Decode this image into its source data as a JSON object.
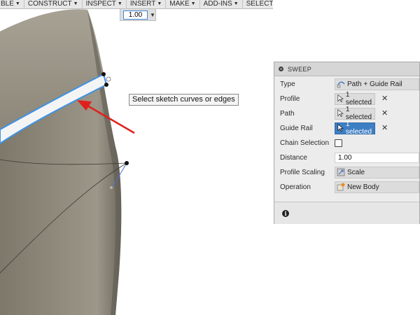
{
  "toolbar": {
    "items": [
      {
        "label": "BLE"
      },
      {
        "label": "CONSTRUCT"
      },
      {
        "label": "INSPECT"
      },
      {
        "label": "INSERT"
      },
      {
        "label": "MAKE"
      },
      {
        "label": "ADD-INS"
      },
      {
        "label": "SELECT"
      }
    ]
  },
  "value_box": {
    "value": "1.00"
  },
  "tooltip": {
    "text": "Select sketch curves or edges"
  },
  "sweep_panel": {
    "title": "SWEEP",
    "rows": {
      "type": {
        "label": "Type",
        "value": "Path + Guide Rail",
        "icon": "path-guide-rail-icon"
      },
      "profile": {
        "label": "Profile",
        "value": "1 selected"
      },
      "path": {
        "label": "Path",
        "value": "1 selected"
      },
      "guide_rail": {
        "label": "Guide Rail",
        "value": "1 selected"
      },
      "chain_selection": {
        "label": "Chain Selection",
        "checked": false
      },
      "distance": {
        "label": "Distance",
        "value": "1.00"
      },
      "profile_scaling": {
        "label": "Profile Scaling",
        "value": "Scale",
        "icon": "scale-icon"
      },
      "operation": {
        "label": "Operation",
        "value": "New Body",
        "icon": "new-body-icon"
      }
    }
  },
  "colors": {
    "accent": "#3e7fc4",
    "annotation_arrow": "#e0201c",
    "model_surface": "#8a8577",
    "selection_highlight": "#3c93e6"
  }
}
